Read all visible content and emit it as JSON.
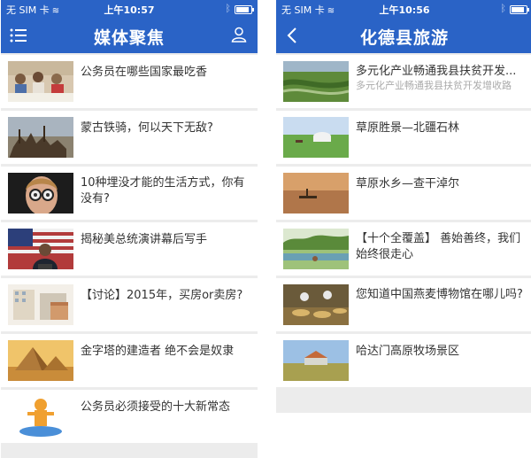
{
  "left_screen": {
    "status": {
      "carrier": "无 SIM 卡",
      "time": "上午10:57"
    },
    "header": {
      "title": "媒体聚焦"
    },
    "items": [
      {
        "title": "公务员在哪些国家最吃香"
      },
      {
        "title": "蒙古铁骑，何以天下无敌?"
      },
      {
        "title": "10种埋没才能的生活方式，你有没有?"
      },
      {
        "title": "揭秘美总统演讲幕后写手"
      },
      {
        "title": "【讨论】2015年，买房or卖房?"
      },
      {
        "title": "金字塔的建造者 绝不会是奴隶"
      },
      {
        "title": "公务员必须接受的十大新常态"
      }
    ]
  },
  "right_screen": {
    "status": {
      "carrier": "无 SIM 卡",
      "time": "上午10:56"
    },
    "header": {
      "title": "化德县旅游"
    },
    "items": [
      {
        "title": "多元化产业畅通我县扶贫开发...",
        "subtitle": "多元化产业畅通我县扶贫开发增收路"
      },
      {
        "title": "草原胜景—北疆石林"
      },
      {
        "title": "草原水乡—查干淖尔"
      },
      {
        "title": "【十个全覆盖】 善始善终，我们始终很走心"
      },
      {
        "title": "您知道中国燕麦博物馆在哪儿吗?"
      },
      {
        "title": "哈达门高原牧场景区"
      }
    ]
  },
  "colors": {
    "header": "#2a63c6",
    "background": "#ececec"
  }
}
